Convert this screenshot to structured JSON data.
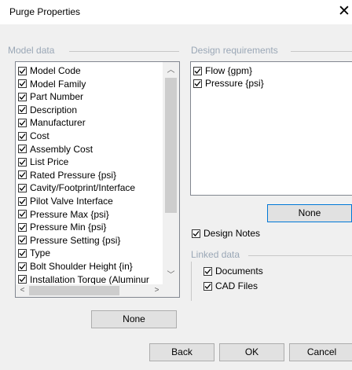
{
  "window": {
    "title": "Purge Properties",
    "close_glyph": "✕"
  },
  "model_data": {
    "group_label": "Model data",
    "items": [
      {
        "label": "Model Code",
        "checked": true
      },
      {
        "label": "Model Family",
        "checked": true
      },
      {
        "label": "Part Number",
        "checked": true
      },
      {
        "label": "Description",
        "checked": true
      },
      {
        "label": "Manufacturer",
        "checked": true
      },
      {
        "label": "Cost",
        "checked": true
      },
      {
        "label": "Assembly Cost",
        "checked": true
      },
      {
        "label": "List Price",
        "checked": true
      },
      {
        "label": "Rated Pressure {psi}",
        "checked": true
      },
      {
        "label": "Cavity/Footprint/Interface",
        "checked": true
      },
      {
        "label": "Pilot Valve Interface",
        "checked": true
      },
      {
        "label": "Pressure Max {psi}",
        "checked": true
      },
      {
        "label": "Pressure Min {psi}",
        "checked": true
      },
      {
        "label": "Pressure Setting {psi}",
        "checked": true
      },
      {
        "label": "Type",
        "checked": true
      },
      {
        "label": "Bolt Shoulder Height {in}",
        "checked": true
      },
      {
        "label": "Installation Torque (Aluminur",
        "checked": true
      }
    ],
    "none_button": "None"
  },
  "design_requirements": {
    "group_label": "Design requirements",
    "items": [
      {
        "label": "Flow {gpm}",
        "checked": true
      },
      {
        "label": "Pressure {psi}",
        "checked": true
      }
    ],
    "none_button": "None"
  },
  "design_notes": {
    "label": "Design Notes",
    "checked": true
  },
  "linked_data": {
    "group_label": "Linked data",
    "items": [
      {
        "label": "Documents",
        "checked": true
      },
      {
        "label": "CAD Files",
        "checked": true
      }
    ]
  },
  "footer": {
    "back": "Back",
    "ok": "OK",
    "cancel": "Cancel"
  },
  "icons": {
    "check": "check-icon",
    "close": "close-icon"
  }
}
